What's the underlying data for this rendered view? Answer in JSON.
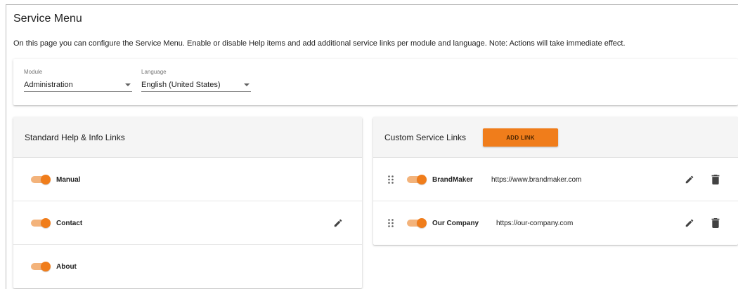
{
  "page": {
    "title": "Service Menu",
    "description": "On this page you can configure the Service Menu. Enable or disable Help items and add additional service links per module and language. Note: Actions will take immediate effect."
  },
  "filters": {
    "module": {
      "label": "Module",
      "value": "Administration"
    },
    "language": {
      "label": "Language",
      "value": "English (United States)"
    }
  },
  "standard_panel": {
    "title": "Standard Help & Info Links",
    "items": [
      {
        "label": "Manual",
        "enabled": true,
        "editable": false
      },
      {
        "label": "Contact",
        "enabled": true,
        "editable": true
      },
      {
        "label": "About",
        "enabled": true,
        "editable": false
      }
    ]
  },
  "custom_panel": {
    "title": "Custom Service Links",
    "add_button": "ADD LINK",
    "items": [
      {
        "label": "BrandMaker",
        "url": "https://www.brandmaker.com",
        "enabled": true
      },
      {
        "label": "Our Company",
        "url": "https://our-company.com",
        "enabled": true
      }
    ]
  },
  "colors": {
    "accent": "#f07d1b",
    "accent_light": "#f3b37b",
    "panel_header": "#f5f5f5",
    "icon": "#424242"
  }
}
